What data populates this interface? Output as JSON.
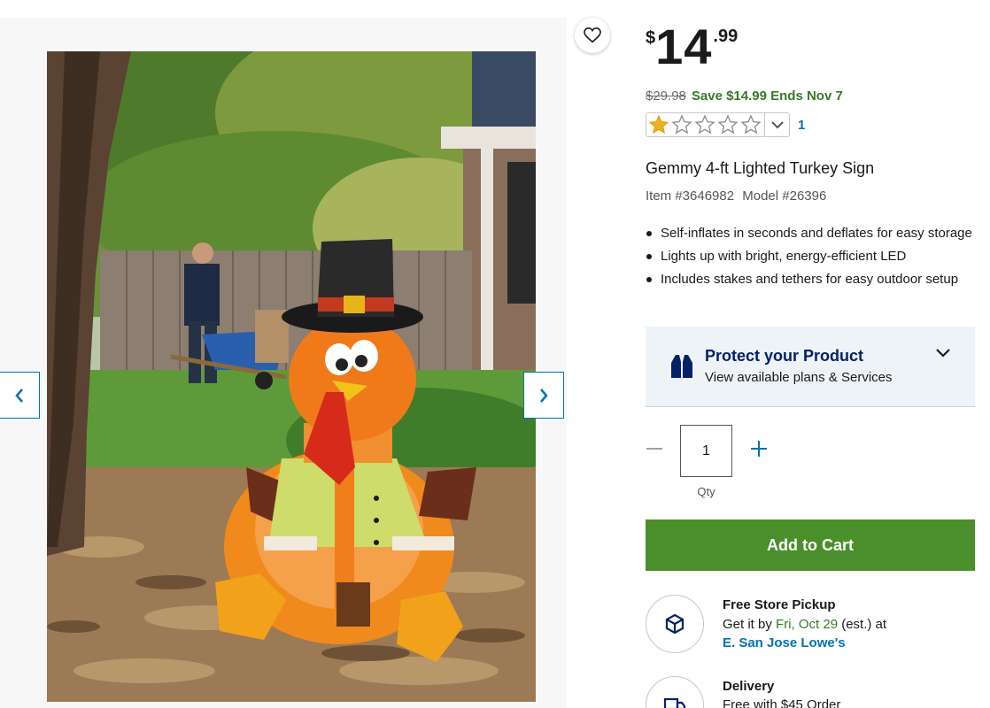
{
  "product": {
    "price_currency": "$",
    "price_dollars": "14",
    "price_cents": ".99",
    "was_price": "$29.98",
    "save_text": "Save $14.99 Ends Nov 7",
    "rating_stars": 1,
    "rating_max": 5,
    "rating_count": "1",
    "title": "Gemmy 4-ft Lighted Turkey Sign",
    "item_number": "Item #3646982",
    "model_number": "Model #26396",
    "bullets": [
      "Self-inflates in seconds and deflates for easy storage",
      "Lights up with bright, energy-efficient LED",
      "Includes stakes and tethers for easy outdoor setup"
    ]
  },
  "protection": {
    "title": "Protect your Product",
    "subtitle": "View available plans & Services"
  },
  "quantity": {
    "value": "1",
    "label": "Qty"
  },
  "cart": {
    "button_label": "Add to Cart"
  },
  "pickup": {
    "title": "Free Store Pickup",
    "prefix": "Get it by ",
    "date": "Fri, Oct 29",
    "suffix": " (est.) at",
    "store": "E. San Jose Lowe's"
  },
  "delivery": {
    "title": "Delivery",
    "text": "Free with $45 Order"
  },
  "icons": {
    "favorite": "heart-icon",
    "prev": "chevron-left-icon",
    "next": "chevron-right-icon",
    "protect": "vest-icon",
    "expand": "chevron-down-icon",
    "minus": "minus-icon",
    "plus": "plus-icon",
    "pickup": "package-icon",
    "delivery": "truck-icon"
  },
  "colors": {
    "brand_blue": "#012169",
    "link_blue": "#0471af",
    "save_green": "#357a27",
    "cart_green": "#4b8f2d",
    "star_gold": "#f2b01e"
  }
}
